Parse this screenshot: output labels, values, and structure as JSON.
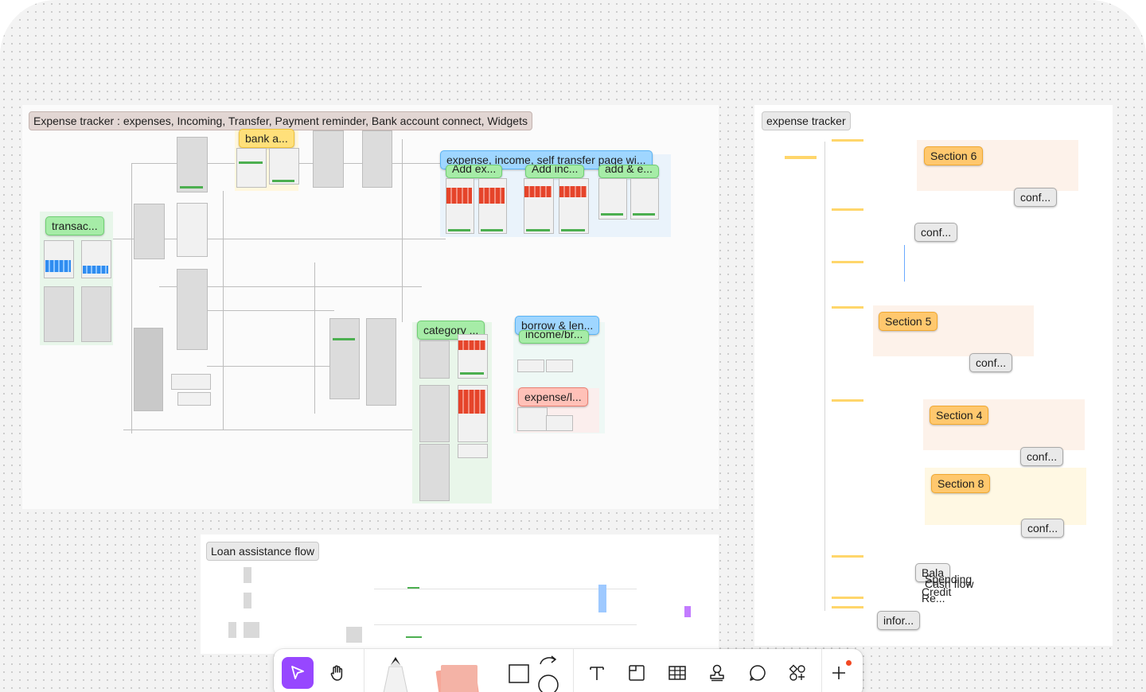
{
  "frames": {
    "main_title": "Expense tracker : expenses, Incoming, Transfer, Payment reminder, Bank account connect, Widgets",
    "right_title": "expense tracker",
    "loan_title": "Loan assistance flow"
  },
  "stickies": {
    "transac": "transac...",
    "bank": "bank a...",
    "expense_income": "expense, income, self transfer page wi...",
    "add_ex": "Add ex...",
    "add_inc": "Add inc...",
    "add_e": "add & e...",
    "category": "category ...",
    "borrow": "borrow & len...",
    "income_br": "income/br...",
    "expense_l": "expense/l..."
  },
  "right_panel": {
    "section6": "Section 6",
    "section5": "Section 5",
    "section4": "Section 4",
    "section8": "Section 8",
    "conf": "conf...",
    "info": "infor...",
    "overlap": [
      "Bala",
      "Spending",
      "Cash flow",
      "Credit",
      "Re..."
    ]
  },
  "toolbar": {
    "tools": [
      "move-tool",
      "hand-tool",
      "pen-tool",
      "sticky-note-tool",
      "shape-tool",
      "connector-tool",
      "text-tool",
      "section-tool",
      "table-tool",
      "stamp-tool",
      "comment-tool",
      "widgets-tool",
      "more-tool"
    ],
    "active": "move-tool",
    "accent": "#9747ff",
    "notification_color": "#f24822"
  }
}
